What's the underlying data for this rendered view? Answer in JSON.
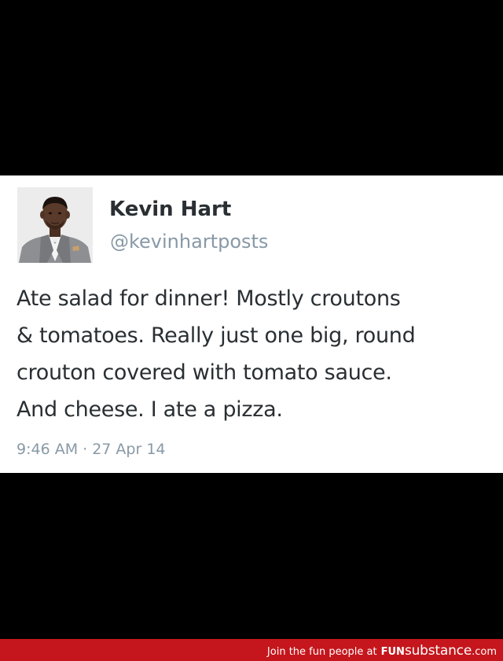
{
  "tweet": {
    "author": {
      "display_name": "Kevin Hart",
      "handle": "@kevinhartposts",
      "avatar_icon": "profile-photo"
    },
    "text_lines": [
      "Ate salad for dinner! Mostly croutons",
      "& tomatoes. Really just one big, round",
      "crouton covered with tomato sauce.",
      "And cheese. I ate a pizza."
    ],
    "timestamp": "9:46 AM · 27 Apr 14"
  },
  "footer": {
    "text": "Join the fun people at",
    "brand_bold": "FUN",
    "brand_rest": "substance",
    "brand_tld": ".com",
    "background_color": "#c4161c"
  },
  "colors": {
    "page_background": "#000000",
    "card_background": "#ffffff",
    "text_primary": "#292f33",
    "text_secondary": "#8899a6"
  }
}
